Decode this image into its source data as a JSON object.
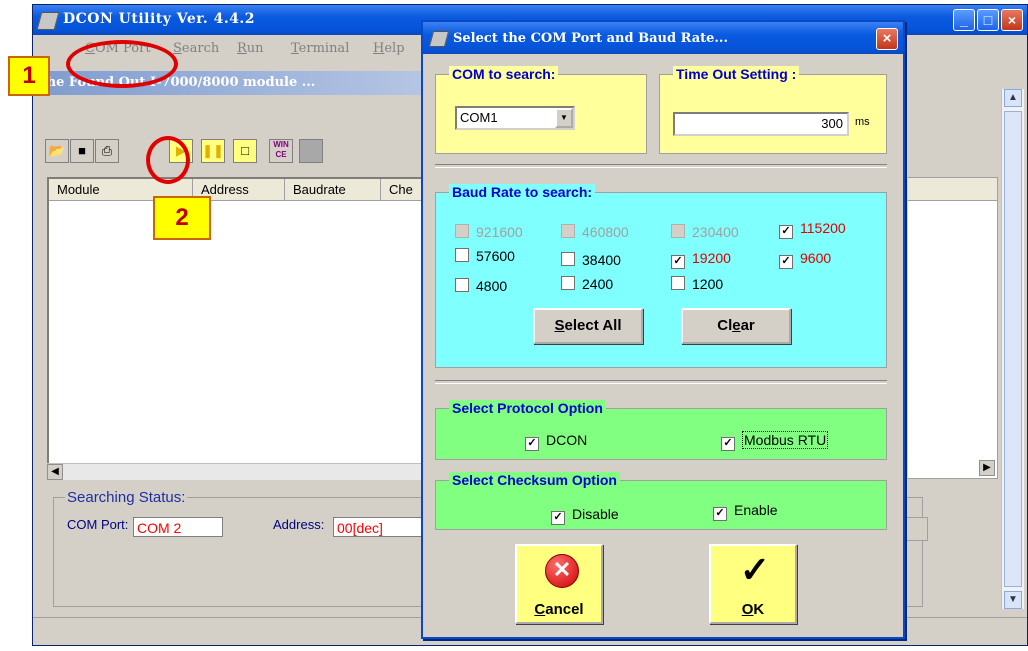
{
  "main": {
    "title": "DCON Utility Ver.  4.4.2",
    "menu": [
      {
        "prefix": "",
        "mn": "C",
        "rest": "OM Port"
      },
      {
        "prefix": "",
        "mn": "S",
        "rest": "earch"
      },
      {
        "prefix": "",
        "mn": "R",
        "rest": "un"
      },
      {
        "prefix": "",
        "mn": "T",
        "rest": "erminal"
      },
      {
        "prefix": "",
        "mn": "H",
        "rest": "elp"
      }
    ],
    "inner_title": "The Found Out I-7000/8000 module ...",
    "toolbar": {
      "wince": "WIN\nCE"
    },
    "columns": [
      "Module",
      "Address",
      "Baudrate",
      "Che"
    ],
    "status": {
      "title": "Searching Status:",
      "com_label": "COM Port:",
      "com_value": "COM 2",
      "address_label": "Address:",
      "address_value": "00[dec]"
    }
  },
  "annotations": {
    "step1": "1",
    "step2": "2"
  },
  "dialog": {
    "title": "Select the COM Port and Baud Rate...",
    "com_group": "COM to search:",
    "com_value": "COM1",
    "timeout_group": "Time Out Setting :",
    "timeout_value": "300",
    "timeout_unit": "ms",
    "baud_group": "Baud Rate to search:",
    "baud_rates": [
      {
        "label": "921600",
        "checked": false,
        "state": "disabled"
      },
      {
        "label": "460800",
        "checked": false,
        "state": "disabled"
      },
      {
        "label": "230400",
        "checked": false,
        "state": "disabled"
      },
      {
        "label": "115200",
        "checked": true,
        "state": "red"
      },
      {
        "label": "57600",
        "checked": false,
        "state": "normal"
      },
      {
        "label": "38400",
        "checked": false,
        "state": "normal"
      },
      {
        "label": "19200",
        "checked": true,
        "state": "red"
      },
      {
        "label": "9600",
        "checked": true,
        "state": "red"
      },
      {
        "label": "4800",
        "checked": false,
        "state": "normal"
      },
      {
        "label": "2400",
        "checked": false,
        "state": "normal"
      },
      {
        "label": "1200",
        "checked": false,
        "state": "normal"
      }
    ],
    "select_all": {
      "mn": "S",
      "rest": "elect  All"
    },
    "clear": {
      "pre": "Cl",
      "mn": "e",
      "rest": "ar"
    },
    "protocol_group": "Select Protocol Option",
    "protocol": [
      {
        "label": "DCON",
        "checked": true
      },
      {
        "label": "Modbus RTU",
        "checked": true
      }
    ],
    "checksum_group": "Select Checksum  Option",
    "checksum": [
      {
        "label": "Disable",
        "checked": true
      },
      {
        "label": "Enable",
        "checked": true
      }
    ],
    "cancel": {
      "mn": "C",
      "rest": "ancel"
    },
    "ok": {
      "mn": "O",
      "rest": "K"
    }
  },
  "colors": {
    "accent_blue": "#0a5ae0",
    "yellow": "#ffff9c",
    "cyan": "#80ffff",
    "green": "#80ff80",
    "red_text": "#e00000"
  }
}
